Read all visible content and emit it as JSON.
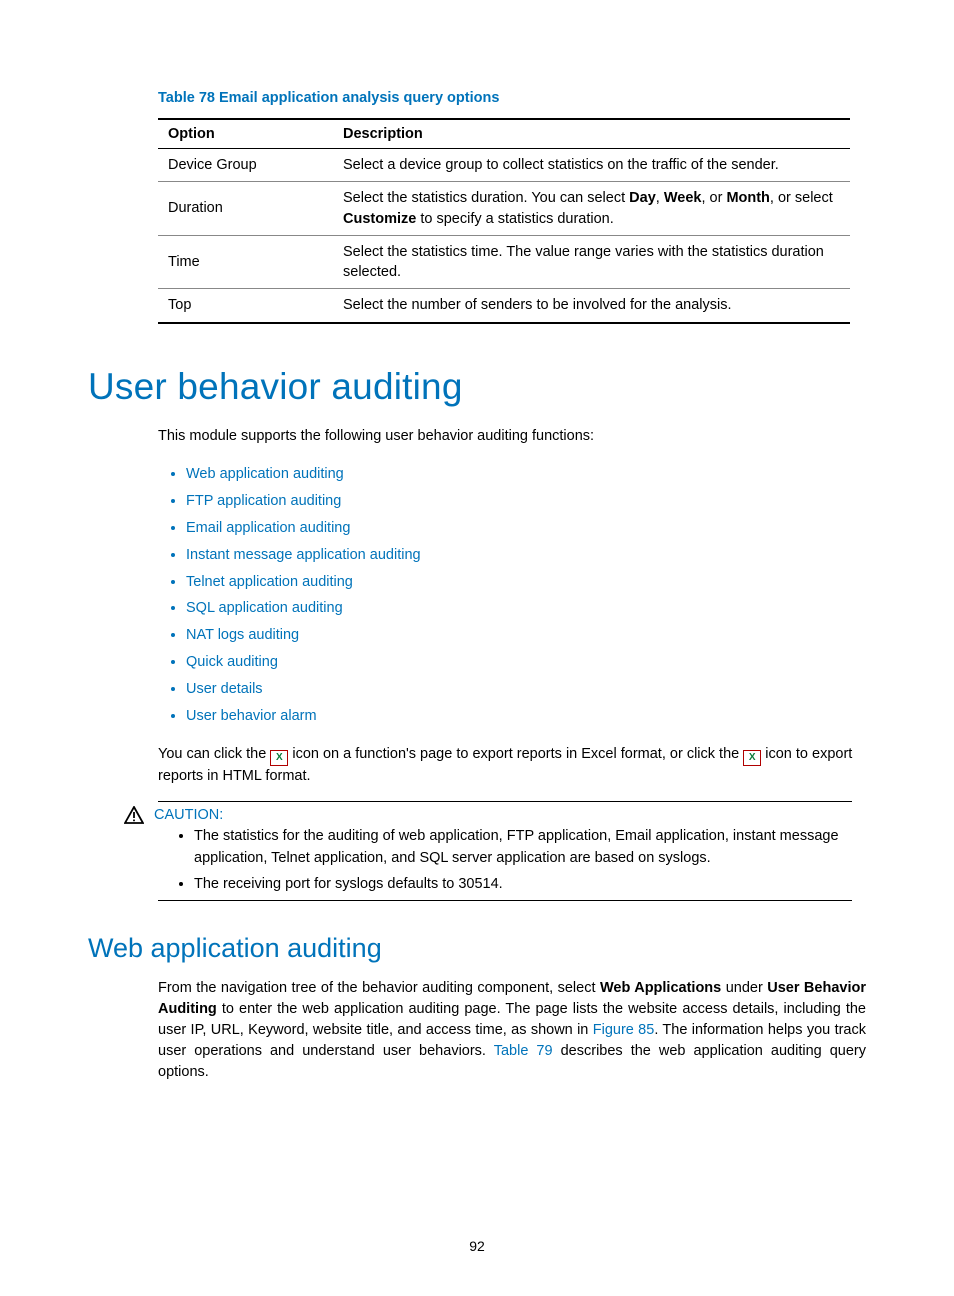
{
  "table78": {
    "caption": "Table 78 Email application analysis query options",
    "headers": {
      "option": "Option",
      "description": "Description"
    },
    "rows": [
      {
        "option": "Device Group",
        "desc": "Select a device group to collect statistics on the traffic of the sender."
      },
      {
        "option": "Duration",
        "desc_pre": "Select the statistics duration. You can select ",
        "b1": "Day",
        "c1": ", ",
        "b2": "Week",
        "c2": ", or ",
        "b3": "Month",
        "c3": ", or select ",
        "b4": "Customize",
        "desc_post": " to specify a statistics duration."
      },
      {
        "option": "Time",
        "desc": "Select the statistics time. The value range varies with the statistics duration selected."
      },
      {
        "option": "Top",
        "desc": "Select the number of senders to be involved for the analysis."
      }
    ]
  },
  "h1": "User behavior auditing",
  "intro": "This module supports the following user behavior auditing functions:",
  "links": [
    "Web application auditing",
    "FTP application auditing",
    "Email application auditing",
    "Instant message application auditing",
    "Telnet application auditing",
    "SQL application auditing",
    "NAT logs auditing",
    "Quick auditing",
    "User details",
    "User behavior alarm"
  ],
  "export_para": {
    "p1": "You can click the ",
    "icon_glyph": "X",
    "p2": " icon on a function's page to export reports in Excel format, or click the ",
    "p3": " icon to export reports in HTML format."
  },
  "caution": {
    "label": "CAUTION:",
    "items": [
      "The statistics for the auditing of web application, FTP application, Email application, instant message application, Telnet application, and SQL server application are based on syslogs.",
      "The receiving port for syslogs defaults to 30514."
    ]
  },
  "h2": "Web application auditing",
  "webpara": {
    "t1": "From the navigation tree of the behavior auditing component, select ",
    "b1": "Web Applications",
    "t2": " under ",
    "b2": "User Behavior Auditing",
    "t3": " to enter the web application auditing page. The page lists the website access details, including the user IP, URL, Keyword, website title, and access time, as shown in ",
    "ref1": "Figure 85",
    "t4": ". The information helps you track user operations and understand user behaviors. ",
    "ref2": "Table 79",
    "t5": " describes the web application auditing query options."
  },
  "pagenum": "92"
}
